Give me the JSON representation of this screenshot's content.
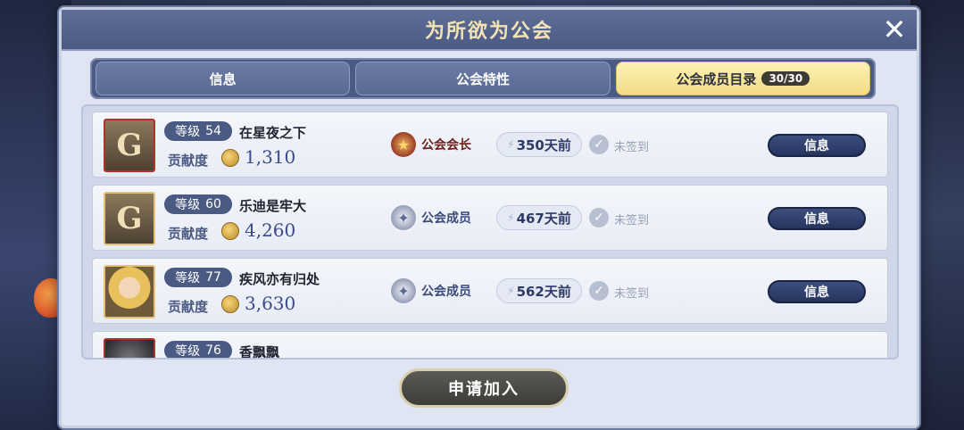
{
  "dialog": {
    "title": "为所欲为公会",
    "close_icon": "close-icon"
  },
  "tabs": [
    {
      "label": "信息",
      "active": false
    },
    {
      "label": "公会特性",
      "active": false
    },
    {
      "label": "公会成员目录",
      "count": "30/30",
      "active": true
    }
  ],
  "members": [
    {
      "level_label": "等级",
      "level": "54",
      "name": "在星夜之下",
      "contrib_label": "贡献度",
      "contrib": "1,310",
      "rank": "公会会长",
      "rank_type": "leader",
      "last_login": "350天前",
      "checkin": "未签到",
      "info_btn": "信息"
    },
    {
      "level_label": "等级",
      "level": "60",
      "name": "乐迪是牢大",
      "contrib_label": "贡献度",
      "contrib": "4,260",
      "rank": "公会成员",
      "rank_type": "member",
      "last_login": "467天前",
      "checkin": "未签到",
      "info_btn": "信息"
    },
    {
      "level_label": "等级",
      "level": "77",
      "name": "疾风亦有归处",
      "contrib_label": "贡献度",
      "contrib": "3,630",
      "rank": "公会成员",
      "rank_type": "member",
      "last_login": "562天前",
      "checkin": "未签到",
      "info_btn": "信息"
    },
    {
      "level_label": "等级",
      "level": "76",
      "name": "香飘飘",
      "contrib_label": "",
      "contrib": "",
      "rank": "",
      "rank_type": "member",
      "last_login": "",
      "checkin": "",
      "info_btn": ""
    }
  ],
  "join_button": "申请加入"
}
